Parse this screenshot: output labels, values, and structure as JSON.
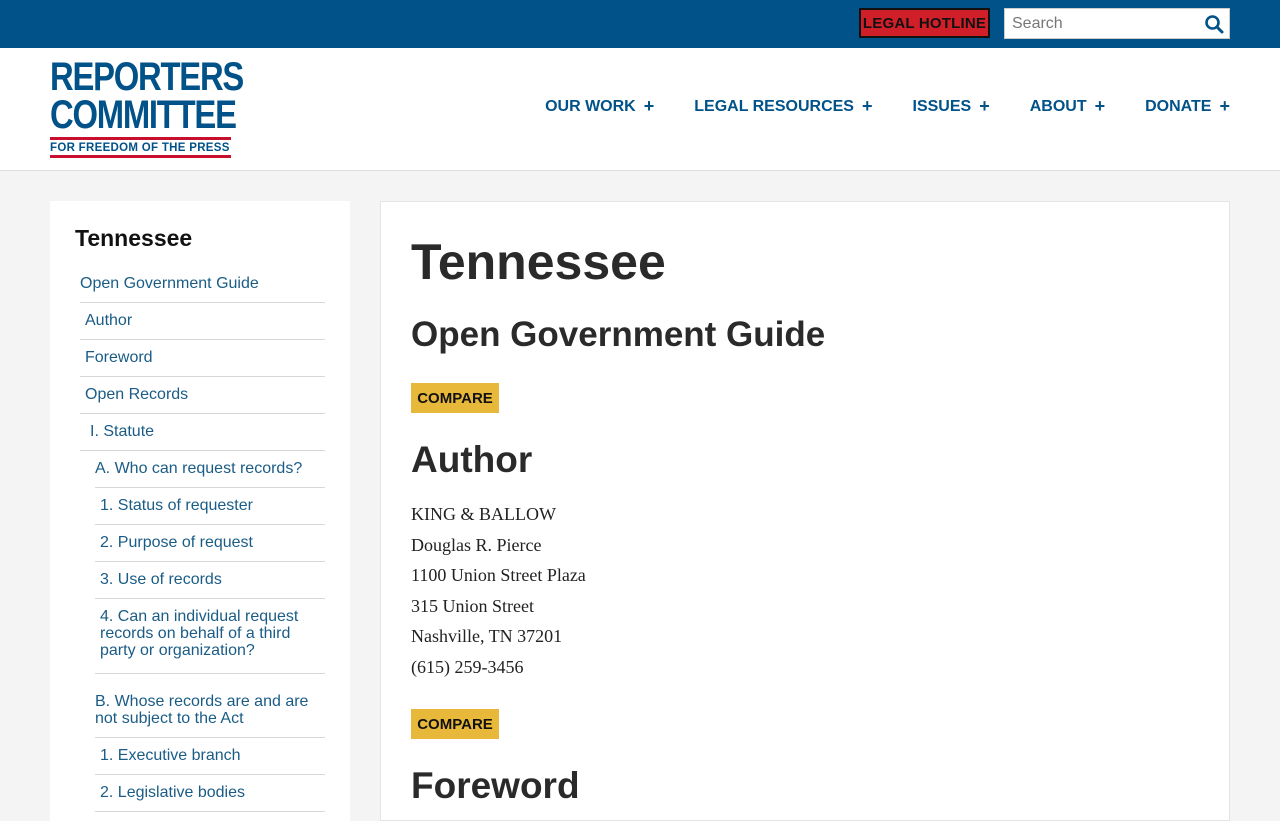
{
  "topbar": {
    "hotline_label": "LEGAL HOTLINE",
    "search_placeholder": "Search"
  },
  "logo": {
    "line1": "REPORTERS",
    "line2": "COMMITTEE",
    "tagline": "FOR FREEDOM OF THE PRESS"
  },
  "nav": {
    "items": [
      {
        "label": "OUR WORK"
      },
      {
        "label": "LEGAL RESOURCES"
      },
      {
        "label": "ISSUES"
      },
      {
        "label": "ABOUT"
      },
      {
        "label": "DONATE"
      }
    ],
    "plus": "+"
  },
  "sidebar": {
    "title": "Tennessee",
    "items": [
      {
        "label": "Open Government Guide"
      },
      {
        "label": "Author"
      },
      {
        "label": "Foreword"
      },
      {
        "label": "Open Records"
      },
      {
        "label": "I. Statute"
      },
      {
        "label": "A. Who can request records?"
      },
      {
        "label": "1. Status of requester"
      },
      {
        "label": "2. Purpose of request"
      },
      {
        "label": "3. Use of records"
      },
      {
        "label": "4. Can an individual request records on behalf of a third party or organization?"
      },
      {
        "label": "B. Whose records are and are not subject to the Act"
      },
      {
        "label": "1. Executive branch"
      },
      {
        "label": "2. Legislative bodies"
      }
    ]
  },
  "main": {
    "title": "Tennessee",
    "subtitle": "Open Government Guide",
    "compare_label": "COMPARE",
    "author_heading": "Author",
    "author_lines": [
      "KING & BALLOW",
      "Douglas R. Pierce",
      "1100 Union Street Plaza",
      "315 Union Street",
      "Nashville, TN 37201",
      "(615) 259-3456"
    ],
    "foreword_heading": "Foreword"
  },
  "colors": {
    "brand_blue": "#005288",
    "hotline_red": "#d11f2a",
    "compare_gold": "#e8b83a",
    "link": "#1a5c86"
  }
}
